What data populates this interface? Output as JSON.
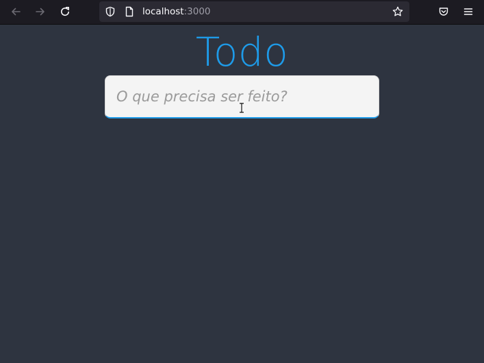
{
  "browser": {
    "url_host": "localhost",
    "url_port": ":3000",
    "icons": {
      "back": "arrow-left-icon",
      "forward": "arrow-right-icon",
      "reload": "reload-icon",
      "tracking_protection": "shield-icon",
      "page_info": "page-icon",
      "bookmark": "star-icon",
      "pocket": "pocket-icon",
      "menu": "hamburger-menu-icon"
    }
  },
  "page": {
    "title": "Todo",
    "input": {
      "placeholder": "O que precisa ser feito?",
      "value": ""
    }
  },
  "colors": {
    "accent": "#1e9be9",
    "background": "#2e3440",
    "toolbar": "#1c1b22",
    "input_background": "#f4f4f4"
  }
}
